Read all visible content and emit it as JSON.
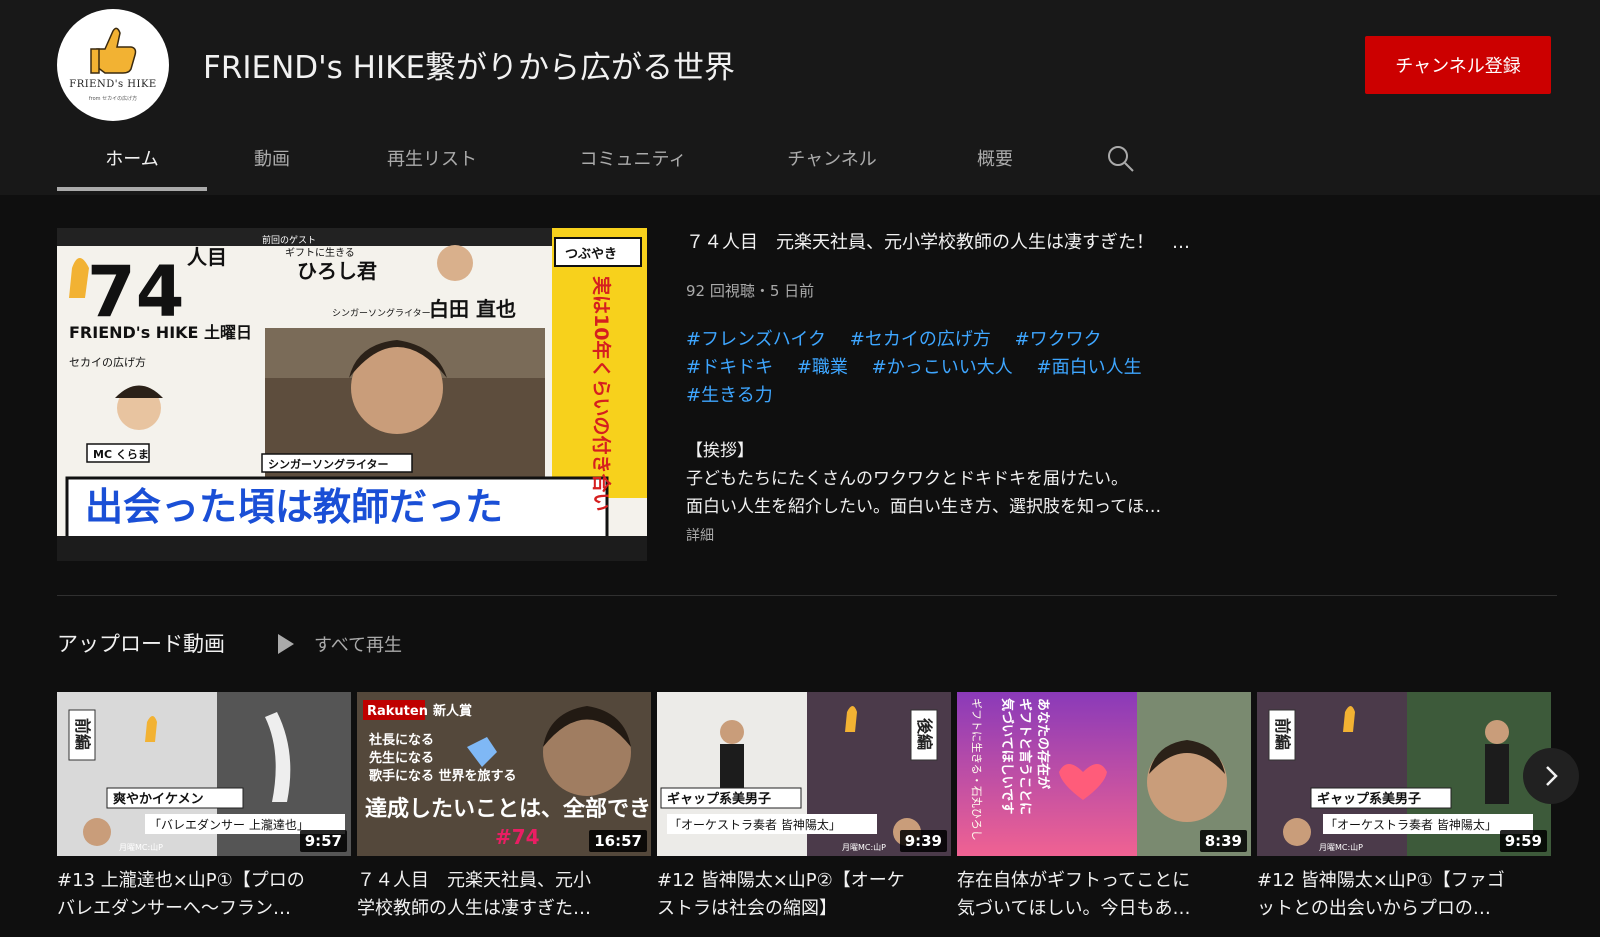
{
  "channel": {
    "name": "FRIEND's HIKE繋がりから広がる世界",
    "logo_text": "FRIEND's HIKE",
    "logo_sub": "from セカイの広げ方",
    "subscribe_label": "チャンネル登録"
  },
  "tabs": [
    {
      "label": "ホーム",
      "active": true
    },
    {
      "label": "動画"
    },
    {
      "label": "再生リスト"
    },
    {
      "label": "コミュニティ"
    },
    {
      "label": "チャンネル"
    },
    {
      "label": "概要"
    }
  ],
  "icons": {
    "search": "search-icon",
    "play": "play-icon",
    "next": "chevron-right-icon"
  },
  "colors": {
    "subscribe": "#cc0000",
    "hashtag": "#3ea6ff",
    "background": "#0f0f0f",
    "header": "#181818"
  },
  "featured": {
    "title": "７４人目　元楽天社員、元小学校教師の人生は凄すぎた！　…",
    "meta": "92 回視聴・5 日前",
    "hashtags": [
      "#フレンズハイク",
      "#セカイの広げ方",
      "#ワクワク",
      "#ドキドキ",
      "#職業",
      "#かっこいい大人",
      "#面白い人生",
      "#生きる力"
    ],
    "description": [
      "【挨拶】",
      "子どもたちにたくさんのワクワクとドキドキを届けたい。",
      "面白い人生を紹介したい。面白い生き方、選択肢を知ってほ…"
    ],
    "details_label": "詳細",
    "thumb_text": {
      "number": "74",
      "unit": "人目",
      "brand": "FRIEND's HIKE 土曜日",
      "guest_prev_label": "前回のゲスト",
      "guest_prev_caption": "ギフトに生きる",
      "guest_prev_name": "ひろし君",
      "guest_role": "シンガーソングライター",
      "guest_name": "白田 直也",
      "side_label": "つぶやき",
      "side_text": "実は10年くらいの付き合い",
      "mc_label": "MC くらま",
      "world": "セカイの広げ方",
      "main_caption": "出会った頃は教師だった",
      "role_tag": "シンガーソングライター"
    }
  },
  "uploads": {
    "section_title": "アップロード動画",
    "play_all_label": "すべて再生",
    "videos": [
      {
        "title_lines": [
          "#13 上瀧達也×山P①【プロの",
          "バレエダンサーへ〜フラン…"
        ],
        "duration": "9:57",
        "thumb": {
          "tag": "前編",
          "sub": "爽やかイケメン",
          "caption": "「バレエダンサー 上瀧達也」",
          "host": "月曜MC:山P"
        }
      },
      {
        "title_lines": [
          "７４人目　元楽天社員、元小",
          "学校教師の人生は凄すぎた…"
        ],
        "duration": "16:57",
        "thumb": {
          "tag": "Rakuten",
          "sub": "新人賞",
          "lines": [
            "社長になる",
            "先生になる",
            "歌手になる 世界を旅する"
          ],
          "caption": "達成したいことは、全部できた",
          "num": "#74"
        }
      },
      {
        "title_lines": [
          "#12 皆神陽太×山P②【オーケ",
          "ストラは社会の縮図】"
        ],
        "duration": "9:39",
        "thumb": {
          "tag": "後編",
          "sub": "ギャップ系美男子",
          "caption": "「オーケストラ奏者 皆神陽太」",
          "host": "月曜MC:山P"
        }
      },
      {
        "title_lines": [
          "存在自体がギフトってことに",
          "気づいてほしい。今日もあ…"
        ],
        "duration": "8:39",
        "thumb": {
          "lines": [
            "あなたの存在が",
            "ギフトと言うことに",
            "気づいてほしいです"
          ],
          "side": "ギフトに生きる・石丸ひろし"
        }
      },
      {
        "title_lines": [
          "#12 皆神陽太×山P①【ファゴ",
          "ットとの出会いからプロの…"
        ],
        "duration": "9:59",
        "thumb": {
          "tag": "前編",
          "sub": "ギャップ系美男子",
          "caption": "「オーケストラ奏者 皆神陽太」",
          "host": "月曜MC:山P"
        }
      }
    ]
  }
}
